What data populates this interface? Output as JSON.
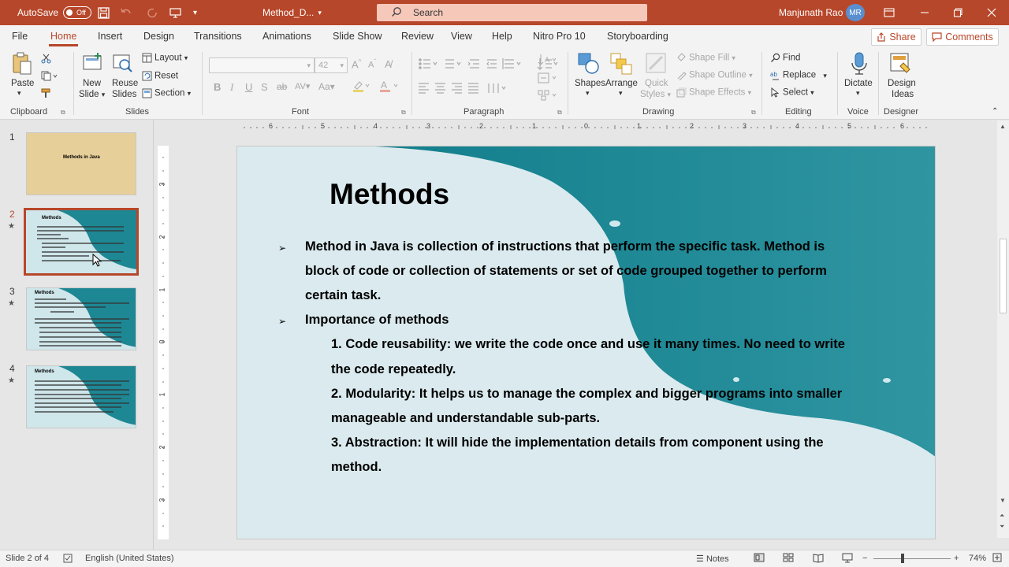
{
  "titlebar": {
    "autosave_label": "AutoSave",
    "autosave_state": "Off",
    "doc_name": "Method_D...",
    "search_placeholder": "Search",
    "user_name": "Manjunath Rao",
    "user_initials": "MR"
  },
  "menu": {
    "tabs": [
      "File",
      "Home",
      "Insert",
      "Design",
      "Transitions",
      "Animations",
      "Slide Show",
      "Review",
      "View",
      "Help",
      "Nitro Pro 10",
      "Storyboarding"
    ],
    "active": "Home",
    "share_label": "Share",
    "comments_label": "Comments"
  },
  "ribbon": {
    "clipboard": {
      "paste": "Paste",
      "label": "Clipboard"
    },
    "slides": {
      "new_slide_1": "New",
      "new_slide_2": "Slide",
      "reuse_1": "Reuse",
      "reuse_2": "Slides",
      "layout": "Layout",
      "reset": "Reset",
      "section": "Section",
      "label": "Slides"
    },
    "font": {
      "size": "42",
      "label": "Font"
    },
    "paragraph": {
      "label": "Paragraph"
    },
    "drawing": {
      "shapes": "Shapes",
      "arrange": "Arrange",
      "quick_1": "Quick",
      "quick_2": "Styles",
      "fill": "Shape Fill",
      "outline": "Shape Outline",
      "effects": "Shape Effects",
      "label": "Drawing"
    },
    "editing": {
      "find": "Find",
      "replace": "Replace",
      "select": "Select",
      "label": "Editing"
    },
    "voice": {
      "dictate": "Dictate",
      "label": "Voice"
    },
    "designer": {
      "ideas_1": "Design",
      "ideas_2": "Ideas",
      "label": "Designer"
    }
  },
  "thumbnails": [
    {
      "num": "1",
      "title": "Methods in Java",
      "starred": false
    },
    {
      "num": "2",
      "title": "Methods",
      "starred": true
    },
    {
      "num": "3",
      "title": "Methods",
      "starred": true
    },
    {
      "num": "4",
      "title": "Methods",
      "starred": true
    }
  ],
  "ruler": {
    "h_labels": [
      "6",
      "5",
      "4",
      "3",
      "2",
      "1",
      "0",
      "1",
      "2",
      "3",
      "4",
      "5",
      "6"
    ],
    "v_labels": [
      "3",
      "2",
      "1",
      "0",
      "1",
      "2",
      "3"
    ]
  },
  "slide": {
    "title": "Methods",
    "lines": [
      "Method in Java is collection of instructions that perform the specific task. Method is",
      "block of code or collection of statements or set of code grouped together to perform",
      "certain task.",
      "Importance of methods",
      "1. Code reusability: we write the code once and use it many times. No need   to write",
      "the code repeatedly.",
      "2. Modularity: It helps us to manage the complex and bigger programs into    smaller",
      "manageable and understandable sub-parts.",
      "3. Abstraction: It will hide the implementation details from component using the",
      "method."
    ]
  },
  "statusbar": {
    "slide_info": "Slide 2 of 4",
    "language": "English (United States)",
    "notes": "Notes",
    "zoom": "74%"
  },
  "colors": {
    "accent": "#b7472a",
    "slide_teal": "#1e8794",
    "slide_light": "#dbeaee"
  }
}
